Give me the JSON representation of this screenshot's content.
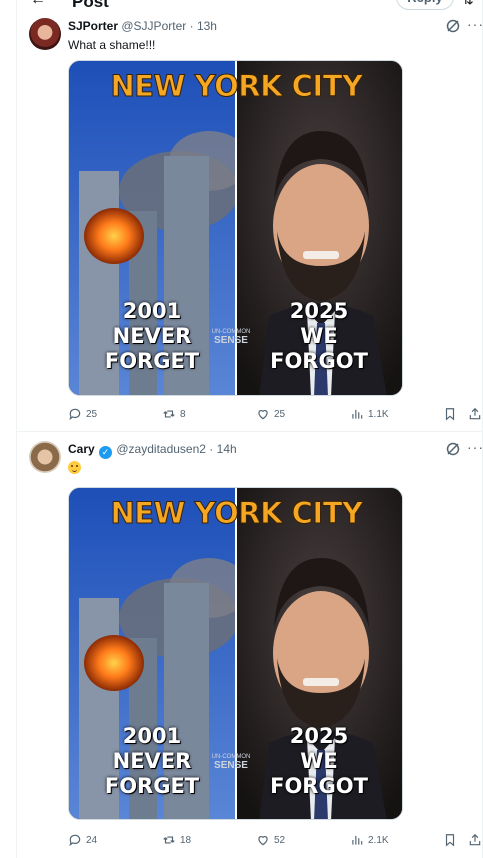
{
  "topbar": {
    "title": "Post",
    "reply_button": "Reply"
  },
  "posts": [
    {
      "name": "SJPorter",
      "handle": "@SJJPorter",
      "dot": "·",
      "time": "13h",
      "verified": false,
      "text": "What a shame!!!",
      "image": {
        "headline": "NEW YORK CITY",
        "left_caption": [
          "2001",
          "NEVER",
          "FORGET"
        ],
        "right_caption": [
          "2025",
          "WE",
          "FORGOT"
        ],
        "watermark": [
          "UN-COMMON",
          "SENSE"
        ]
      },
      "stats": {
        "replies": "25",
        "reposts": "8",
        "likes": "25",
        "views": "1.1K"
      }
    },
    {
      "name": "Cary",
      "handle": "@zayditadusen2",
      "dot": "·",
      "time": "14h",
      "verified": true,
      "text": "",
      "image": {
        "headline": "NEW YORK CITY",
        "left_caption": [
          "2001",
          "NEVER",
          "FORGET"
        ],
        "right_caption": [
          "2025",
          "WE",
          "FORGOT"
        ],
        "watermark": [
          "UN-COMMON",
          "SENSE"
        ]
      },
      "stats": {
        "replies": "24",
        "reposts": "18",
        "likes": "52",
        "views": "2.1K"
      }
    }
  ],
  "colors": {
    "accent": "#1d9bf0",
    "headline": "#f5a623",
    "muted": "#536471",
    "text": "#0f1419"
  },
  "icons": [
    "back-arrow-icon",
    "filter-icon",
    "grok-icon",
    "more-icon",
    "reply-icon",
    "repost-icon",
    "like-icon",
    "views-icon",
    "bookmark-icon",
    "share-icon",
    "verified-badge-icon",
    "emoji-icon"
  ]
}
